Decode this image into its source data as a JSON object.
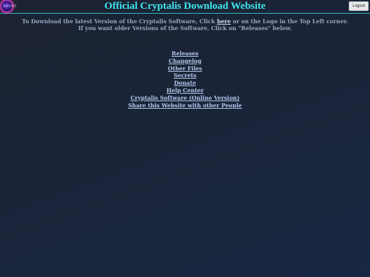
{
  "header": {
    "title": "Official Cryptalis Download Website",
    "logo_text": "ⒸⓇⓎⓅⓉ",
    "logout_label": "Logout"
  },
  "intro": {
    "line1_before": "To Download the latest Version of the Cryptalis Software, Click ",
    "line1_link": "here",
    "line1_after": " or on the Logo in the Top Left corner.",
    "line2": "If you want older Versions of the Software, Click on \"Releases\" below."
  },
  "links": [
    "Releases",
    "Changelog",
    "Other Files",
    "Secrets",
    "Donate",
    "Help Center",
    "Cryptalis Software (Online Version)",
    "Share this Website with other People"
  ],
  "colors": {
    "title": "#3fe6ee",
    "header_border": "#2fc0c8",
    "background": "#1a2438",
    "link": "#b4c8ec"
  }
}
